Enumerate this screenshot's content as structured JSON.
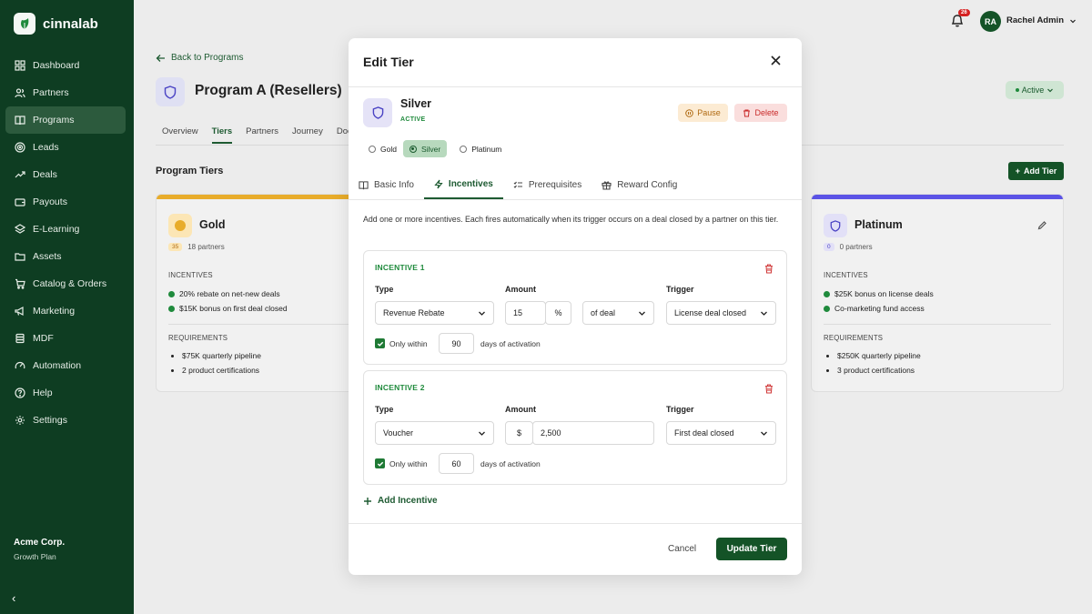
{
  "app": {
    "name": "cinnalab"
  },
  "sidebar": {
    "items": [
      {
        "label": "Dashboard",
        "icon": "grid-icon"
      },
      {
        "label": "Partners",
        "icon": "users-icon"
      },
      {
        "label": "Programs",
        "icon": "book-icon"
      },
      {
        "label": "Leads",
        "icon": "target-icon"
      },
      {
        "label": "Deals",
        "icon": "trend-icon"
      },
      {
        "label": "Payouts",
        "icon": "wallet-icon"
      },
      {
        "label": "E-Learning",
        "icon": "layers-icon"
      },
      {
        "label": "Assets",
        "icon": "folder-icon"
      },
      {
        "label": "Catalog & Orders",
        "icon": "cart-icon"
      },
      {
        "label": "Marketing",
        "icon": "megaphone-icon"
      },
      {
        "label": "MDF",
        "icon": "stack-icon"
      },
      {
        "label": "Automation",
        "icon": "gauge-icon"
      },
      {
        "label": "Help",
        "icon": "help-icon"
      },
      {
        "label": "Settings",
        "icon": "gear-icon"
      }
    ],
    "active": "Programs",
    "org_name": "Acme Corp.",
    "org_plan": "Growth Plan",
    "collapse": "‹"
  },
  "header": {
    "notif_count": "26",
    "avatar_initials": "RA",
    "user_name": "Rachel Admin"
  },
  "page": {
    "back": "Back to Programs",
    "title": "Program A (Resellers)",
    "status": "Active",
    "tabs": [
      "Overview",
      "Tiers",
      "Partners",
      "Journey",
      "Doc"
    ],
    "section_title": "Program Tiers",
    "add_tier": "Add Tier"
  },
  "cards": {
    "gold": {
      "name": "Gold",
      "count_badge": "35",
      "count": "18 partners",
      "inc_label": "INCENTIVES",
      "incentives": [
        "20% rebate on net-new deals",
        "$15K bonus on first deal closed"
      ],
      "req_label": "REQUIREMENTS",
      "requirements": [
        "$75K quarterly pipeline",
        "2 product certifications"
      ],
      "color": "#e8ac2a"
    },
    "platinum": {
      "name": "Platinum",
      "count_badge": "0",
      "count": "0 partners",
      "inc_label": "INCENTIVES",
      "incentives": [
        "$25K bonus on license deals",
        "Co-marketing fund access"
      ],
      "req_label": "REQUIREMENTS",
      "requirements": [
        "$250K quarterly pipeline",
        "3 product certifications"
      ],
      "color": "#5b53e6"
    }
  },
  "modal": {
    "title": "Edit Tier",
    "tier_name": "Silver",
    "tier_status": "ACTIVE",
    "pause": "Pause",
    "delete": "Delete",
    "radios": [
      "Gold",
      "Silver",
      "Platinum"
    ],
    "selected_radio": "Silver",
    "tabs": [
      "Basic Info",
      "Incentives",
      "Prerequisites",
      "Reward Config"
    ],
    "active_tab": "Incentives",
    "description": "Add one or more incentives. Each fires automatically when its trigger occurs on a deal closed by a partner on this tier.",
    "labels": {
      "type": "Type",
      "amount": "Amount",
      "trigger": "Trigger",
      "only_within": "Only within",
      "days_of_activation": "days of activation"
    },
    "incentives": [
      {
        "heading": "INCENTIVE 1",
        "type": "Revenue Rebate",
        "amount": "15",
        "unit": "%",
        "basis": "of deal",
        "trigger": "License deal closed",
        "days": "90"
      },
      {
        "heading": "INCENTIVE 2",
        "type": "Voucher",
        "currency": "$",
        "amount": "2,500",
        "trigger": "First deal closed",
        "days": "60"
      }
    ],
    "add_incentive": "Add Incentive",
    "cancel": "Cancel",
    "update": "Update Tier"
  },
  "colors": {
    "sidebar": "#0e3d22",
    "primary": "#145327",
    "success": "#1f8a3c",
    "danger": "#c92a2a",
    "warning": "#b06a12"
  }
}
